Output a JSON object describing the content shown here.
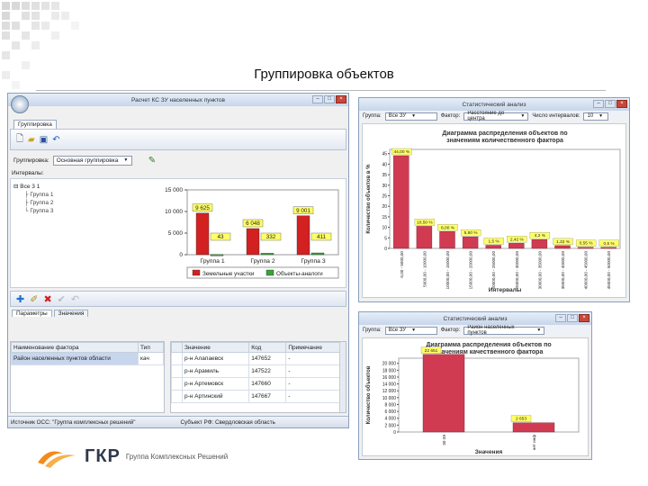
{
  "slide": {
    "title": "Группировка объектов"
  },
  "main_window": {
    "title": "Расчет КС ЗУ населенных пунктов",
    "ribbon_tab": "Группировка",
    "group_label": "Группировка:",
    "group_value": "Основная группировка",
    "intervals_label": "Интервалы:",
    "tree": {
      "root": "Все 3 1",
      "children": [
        "Группа 1",
        "Группа 2",
        "Группа 3"
      ]
    },
    "chart_data": {
      "type": "bar",
      "categories": [
        "Группа 1",
        "Группа 2",
        "Группа 3"
      ],
      "series": [
        {
          "name": "Земельные участки",
          "values": [
            9625,
            6048,
            9001
          ],
          "color": "#d32020"
        },
        {
          "name": "Объекты-аналоги",
          "values": [
            43,
            332,
            411
          ],
          "color": "#3aa23a"
        }
      ],
      "value_labels": [
        [
          "9 625",
          "6 048",
          "9 001"
        ],
        [
          "43",
          "332",
          "411"
        ]
      ],
      "yticks": [
        "15 000",
        "10 000",
        "5 000",
        "0"
      ],
      "ylim": [
        0,
        15000
      ]
    },
    "bottom_tabs": [
      "Параметры",
      "Значения"
    ],
    "factor_grid": {
      "headers": [
        "Наименование фактора",
        "Тип"
      ],
      "rows": [
        [
          "Район населенных пунктов области",
          "кач"
        ]
      ]
    },
    "values_grid": {
      "headers": [
        "Значение",
        "Код",
        "Примечание"
      ],
      "rows": [
        [
          "р-н Алапаевск",
          "147652",
          "-"
        ],
        [
          "р-н Арамиль",
          "147522",
          "-"
        ],
        [
          "р-н Артемовск",
          "147660",
          "-"
        ],
        [
          "р-н Артинский",
          "147667",
          "-"
        ]
      ]
    },
    "status_left": "Источник ОСС: \"Группа комплексных решений\"",
    "status_right": "Субъект РФ: Свердловская область"
  },
  "quant_window": {
    "title": "Статистический анализ",
    "group_label": "Группа:",
    "group_value": "Все ЗУ",
    "factor_label": "Фактор:",
    "factor_value": "Расстояние до центра",
    "intervals_label": "Число интервалов:",
    "intervals_value": "10",
    "chart_data": {
      "type": "bar",
      "title": "Диаграмма распределения объектов по значениям количественного фактора",
      "ylabel": "Количество объектов в %",
      "xlabel": "Интервалы",
      "categories": [
        "0,00 - 5000,00",
        "5000,00 - 10000,00",
        "10000,00 - 15000,00",
        "15000,00 - 20000,00",
        "20000,00 - 25000,00",
        "25000,00 - 30000,00",
        "30000,00 - 35000,00",
        "35000,00 - 40000,00",
        "40000,00 - 45000,00",
        "45000,00 - 50000,00"
      ],
      "values": [
        44.0,
        10.5,
        8.0,
        5.5,
        1.5,
        2.42,
        4.2,
        1.32,
        0.55,
        0.5
      ],
      "labels": [
        "44,00 %",
        "10,50 %",
        "8,00 %",
        "5,50 %",
        "1,5 %",
        "2,42 %",
        "4,2 %",
        "1,32 %",
        "0,55 %",
        "0,5 %"
      ],
      "yticks": [
        "45",
        "40",
        "35",
        "30",
        "25",
        "20",
        "15",
        "10",
        "5",
        "0"
      ],
      "ylim": [
        0,
        47
      ],
      "color": "#d03b52"
    }
  },
  "qual_window": {
    "title": "Статистический анализ",
    "group_label": "Группа:",
    "group_value": "Все ЗУ",
    "factor_label": "Фактор:",
    "factor_value": "Район населенных пунктов",
    "chart_data": {
      "type": "bar",
      "title": "Диаграмма распределения объектов по значениям качественного фактора",
      "ylabel": "Количество объектов",
      "xlabel": "Значения",
      "categories": [
        "30-39",
        "нет инф"
      ],
      "values": [
        22600,
        2700
      ],
      "labels": [
        "22 651",
        "2 653"
      ],
      "yticks": [
        "20 000",
        "18 000",
        "16 000",
        "14 000",
        "12 000",
        "10 000",
        "8 000",
        "6 000",
        "4 000",
        "2 000",
        "0"
      ],
      "ylim": [
        0,
        21500
      ],
      "color": "#d03b52"
    }
  },
  "logo": {
    "name": "ГКР",
    "subtitle": "Группа Комплексных Решений"
  }
}
